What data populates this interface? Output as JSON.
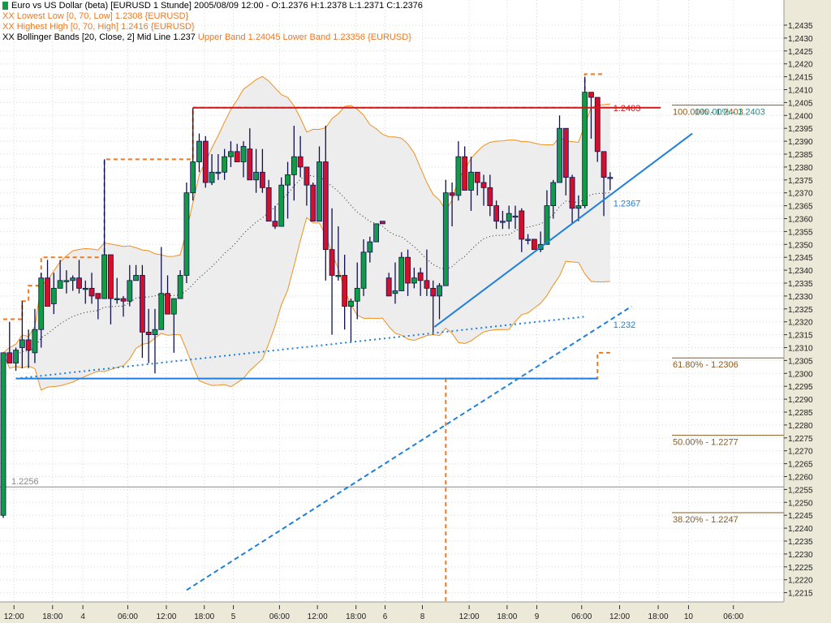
{
  "legend": {
    "main": "Euro vs US Dollar (beta) [EURUSD  1 Stunde] 2005/08/09 12:00 - O:1.2376 H:1.2378 L:1.2371 C:1.2376",
    "lowest_low": "XX Lowest Low [0, 70, Low] 1.2308 {EURUSD}",
    "highest_high": "XX Highest High [0, 70, High] 1.2416 {EURUSD}",
    "bollinger_prefix": "XX Bollinger Bands [20, Close, 2] Mid Line 1.237 ",
    "bollinger_bands": "Upper Band 1.24045 Lower Band 1.23356 {EURUSD}"
  },
  "colors": {
    "up": "#129a48",
    "down": "#d0102c",
    "wick": "#101050",
    "band": "#f0901e",
    "band_fill": "#ededed",
    "hh_ll": "#f07820",
    "trend": "#1e7fdc",
    "resistance": "#d01818",
    "fib": "#8a5a20",
    "fib2": "#2a8a8a",
    "axis_bg": "#ece9d8"
  },
  "chart_data": {
    "type": "candlestick",
    "title": "Euro vs US Dollar (beta) [EURUSD 1 Stunde]",
    "ylim": [
      1.2215,
      1.2435
    ],
    "y_tick_step": 0.0005,
    "grid": true,
    "x_ticks": [
      {
        "i": 1.7,
        "label": "12:00"
      },
      {
        "i": 7.8,
        "label": "18:00"
      },
      {
        "i": 12.6,
        "label": "4"
      },
      {
        "i": 19.7,
        "label": "06:00"
      },
      {
        "i": 25.8,
        "label": "12:00"
      },
      {
        "i": 31.8,
        "label": "18:00"
      },
      {
        "i": 36.4,
        "label": "5"
      },
      {
        "i": 43.7,
        "label": "06:00"
      },
      {
        "i": 49.7,
        "label": "12:00"
      },
      {
        "i": 55.8,
        "label": "18:00"
      },
      {
        "i": 60.4,
        "label": "6"
      },
      {
        "i": 66.3,
        "label": "8"
      },
      {
        "i": 73.7,
        "label": "12:00"
      },
      {
        "i": 79.7,
        "label": "18:00"
      },
      {
        "i": 84.4,
        "label": "9"
      },
      {
        "i": 91.5,
        "label": "06:00"
      },
      {
        "i": 97.5,
        "label": "12:00"
      },
      {
        "i": 103.6,
        "label": "18:00"
      },
      {
        "i": 108.4,
        "label": "10"
      },
      {
        "i": 115.5,
        "label": "06:00"
      }
    ],
    "candles": [
      [
        1.2245,
        1.2308,
        1.2244,
        1.2308
      ],
      [
        1.2308,
        1.232,
        1.2304,
        1.2304
      ],
      [
        1.2304,
        1.231,
        1.2301,
        1.2309
      ],
      [
        1.231,
        1.2328,
        1.2302,
        1.2313
      ],
      [
        1.2313,
        1.2317,
        1.2302,
        1.2309
      ],
      [
        1.2308,
        1.2325,
        1.2304,
        1.2317
      ],
      [
        1.2317,
        1.2339,
        1.231,
        1.2337
      ],
      [
        1.2337,
        1.2344,
        1.2326,
        1.2326
      ],
      [
        1.2327,
        1.2339,
        1.2323,
        1.2333
      ],
      [
        1.2333,
        1.2344,
        1.2333,
        1.2336
      ],
      [
        1.2336,
        1.234,
        1.2331,
        1.2336
      ],
      [
        1.2336,
        1.2338,
        1.2332,
        1.2337
      ],
      [
        1.2337,
        1.2344,
        1.2331,
        1.2333
      ],
      [
        1.2333,
        1.2336,
        1.2327,
        1.2333
      ],
      [
        1.2333,
        1.2339,
        1.2327,
        1.233
      ],
      [
        1.2331,
        1.2331,
        1.2321,
        1.2329
      ],
      [
        1.2329,
        1.2383,
        1.2329,
        1.2346
      ],
      [
        1.2346,
        1.2346,
        1.2319,
        1.2329
      ],
      [
        1.2329,
        1.2337,
        1.2327,
        1.2329
      ],
      [
        1.2329,
        1.233,
        1.2322,
        1.2328
      ],
      [
        1.2328,
        1.2342,
        1.2326,
        1.2336
      ],
      [
        1.2336,
        1.2342,
        1.2336,
        1.2338
      ],
      [
        1.2338,
        1.2342,
        1.2306,
        1.2316
      ],
      [
        1.2316,
        1.2325,
        1.2304,
        1.2315
      ],
      [
        1.2315,
        1.2325,
        1.23,
        1.2317
      ],
      [
        1.2317,
        1.2349,
        1.2317,
        1.2331
      ],
      [
        1.2331,
        1.2338,
        1.2323,
        1.2323
      ],
      [
        1.2323,
        1.2329,
        1.2308,
        1.2329
      ],
      [
        1.2329,
        1.234,
        1.2329,
        1.2338
      ],
      [
        1.2338,
        1.2374,
        1.2335,
        1.237
      ],
      [
        1.237,
        1.2403,
        1.2367,
        1.2382
      ],
      [
        1.2382,
        1.2393,
        1.2378,
        1.239
      ],
      [
        1.239,
        1.2392,
        1.2372,
        1.2374
      ],
      [
        1.2374,
        1.2385,
        1.2373,
        1.2378
      ],
      [
        1.2378,
        1.2385,
        1.2375,
        1.2378
      ],
      [
        1.2378,
        1.2387,
        1.2375,
        1.2384
      ],
      [
        1.2384,
        1.239,
        1.238,
        1.2386
      ],
      [
        1.2386,
        1.2389,
        1.2382,
        1.2382
      ],
      [
        1.2382,
        1.239,
        1.2376,
        1.2388
      ],
      [
        1.2387,
        1.2395,
        1.2375,
        1.2375
      ],
      [
        1.2375,
        1.2387,
        1.237,
        1.2378
      ],
      [
        1.2378,
        1.2387,
        1.237,
        1.2372
      ],
      [
        1.2372,
        1.2375,
        1.2359,
        1.2359
      ],
      [
        1.2359,
        1.2365,
        1.2356,
        1.2357
      ],
      [
        1.2357,
        1.2376,
        1.2357,
        1.2373
      ],
      [
        1.2373,
        1.2382,
        1.236,
        1.2377
      ],
      [
        1.2377,
        1.2396,
        1.2367,
        1.2384
      ],
      [
        1.2384,
        1.2392,
        1.2376,
        1.238
      ],
      [
        1.238,
        1.238,
        1.2365,
        1.2373
      ],
      [
        1.2373,
        1.2374,
        1.2359,
        1.2359
      ],
      [
        1.2359,
        1.2388,
        1.2359,
        1.2382
      ],
      [
        1.2382,
        1.2396,
        1.2336,
        1.2348
      ],
      [
        1.2348,
        1.2364,
        1.2315,
        1.2338
      ],
      [
        1.2338,
        1.2357,
        1.2336,
        1.2338
      ],
      [
        1.2338,
        1.2346,
        1.2317,
        1.2326
      ],
      [
        1.2326,
        1.2329,
        1.2312,
        1.2328
      ],
      [
        1.2328,
        1.2343,
        1.2321,
        1.2333
      ],
      [
        1.2333,
        1.2352,
        1.233,
        1.2347
      ],
      [
        1.2347,
        1.2353,
        1.2343,
        1.2351
      ],
      [
        1.2351,
        1.2358,
        1.2351,
        1.2358
      ],
      [
        1.2359,
        1.2359,
        1.2358,
        1.2358
      ],
      [
        1.2337,
        1.2339,
        1.233,
        1.233
      ],
      [
        1.2331,
        1.2343,
        1.2327,
        1.2332
      ],
      [
        1.2332,
        1.2347,
        1.2332,
        1.2345
      ],
      [
        1.2345,
        1.2348,
        1.233,
        1.2335
      ],
      [
        1.2335,
        1.2341,
        1.2333,
        1.2337
      ],
      [
        1.2339,
        1.2341,
        1.233,
        1.2336
      ],
      [
        1.2336,
        1.2348,
        1.233,
        1.2333
      ],
      [
        1.2333,
        1.2336,
        1.2315,
        1.233
      ],
      [
        1.233,
        1.2335,
        1.2321,
        1.2334
      ],
      [
        1.2334,
        1.2375,
        1.2334,
        1.237
      ],
      [
        1.237,
        1.2374,
        1.2357,
        1.2369
      ],
      [
        1.2369,
        1.239,
        1.2367,
        1.2384
      ],
      [
        1.2384,
        1.2388,
        1.2371,
        1.2371
      ],
      [
        1.2371,
        1.2384,
        1.2363,
        1.2378
      ],
      [
        1.2378,
        1.2378,
        1.2369,
        1.2374
      ],
      [
        1.2374,
        1.2377,
        1.2365,
        1.2372
      ],
      [
        1.2372,
        1.2377,
        1.2361,
        1.2365
      ],
      [
        1.2365,
        1.2367,
        1.2356,
        1.2359
      ],
      [
        1.2359,
        1.2363,
        1.2356,
        1.2359
      ],
      [
        1.2359,
        1.2365,
        1.2356,
        1.2362
      ],
      [
        1.2361,
        1.2365,
        1.2356,
        1.2361
      ],
      [
        1.2363,
        1.2364,
        1.2347,
        1.2352
      ],
      [
        1.2352,
        1.2354,
        1.235,
        1.2352
      ],
      [
        1.2352,
        1.2352,
        1.2348,
        1.2348
      ],
      [
        1.2348,
        1.2355,
        1.2347,
        1.235
      ],
      [
        1.235,
        1.2371,
        1.235,
        1.2365
      ],
      [
        1.2365,
        1.2375,
        1.236,
        1.2374
      ],
      [
        1.2374,
        1.24,
        1.2374,
        1.2395
      ],
      [
        1.2395,
        1.2395,
        1.2369,
        1.2376
      ],
      [
        1.2376,
        1.2377,
        1.2358,
        1.2364
      ],
      [
        1.2364,
        1.2369,
        1.2359,
        1.2365
      ],
      [
        1.2365,
        1.2415,
        1.2364,
        1.2409
      ],
      [
        1.2409,
        1.2409,
        1.2391,
        1.2407
      ],
      [
        1.2407,
        1.2407,
        1.2382,
        1.2386
      ],
      [
        1.2386,
        1.2386,
        1.2361,
        1.2376
      ],
      [
        1.2376,
        1.2378,
        1.2371,
        1.2376
      ]
    ],
    "highest_high_steps": [
      [
        0,
        1.2321
      ],
      [
        3,
        1.2328
      ],
      [
        4,
        1.2334
      ],
      [
        6,
        1.2345
      ],
      [
        16,
        1.2383
      ],
      [
        30,
        1.2403
      ],
      [
        92,
        1.2416
      ],
      [
        95,
        1.2416
      ]
    ],
    "lowest_low_steps": [
      [
        69,
        1.22
      ],
      [
        70,
        1.2298
      ],
      [
        93,
        1.2298
      ],
      [
        94,
        1.2308
      ],
      [
        96,
        1.2308
      ]
    ],
    "bollinger": {
      "period": 20,
      "deviations": 2
    },
    "lines": [
      {
        "name": "resistance-line",
        "style": "solid",
        "color": "resistance",
        "from": [
          30,
          1.2403
        ],
        "to": [
          104,
          1.2403
        ],
        "label": "1.2403",
        "label_at": [
          96.5,
          1.2403
        ]
      },
      {
        "name": "support-line",
        "style": "solid",
        "color": "trend",
        "from": [
          2,
          1.2298
        ],
        "to": [
          94,
          1.2298
        ]
      },
      {
        "name": "dotted-trendline",
        "style": "dotted",
        "color": "trend",
        "from": [
          2,
          1.2298
        ],
        "to": [
          92,
          1.2322
        ]
      },
      {
        "name": "rising-trendline",
        "style": "solid",
        "color": "trend",
        "from": [
          68.2,
          1.2318
        ],
        "to": [
          109,
          1.2393
        ],
        "label": "1.2367",
        "label_at": [
          96.5,
          1.2366
        ]
      },
      {
        "name": "dashed-trendline",
        "style": "dashed",
        "color": "trend",
        "from": [
          29,
          1.2216
        ],
        "to": [
          99.4,
          1.2326
        ],
        "label": "1.232",
        "label_at": [
          96.5,
          1.2319
        ]
      }
    ],
    "price_line": {
      "value": 1.2256,
      "label": "1.2256"
    },
    "fib_levels": [
      {
        "label": "100.00% - 1.2403",
        "value": 1.2404
      },
      {
        "label": "61.80% - 1.2306",
        "value": 1.2306
      },
      {
        "label": "50.00% - 1.2277",
        "value": 1.2276
      },
      {
        "label": "38.20% - 1.2247",
        "value": 1.2246
      }
    ],
    "fib_overlay_label": "100.00% - 1.2403"
  }
}
